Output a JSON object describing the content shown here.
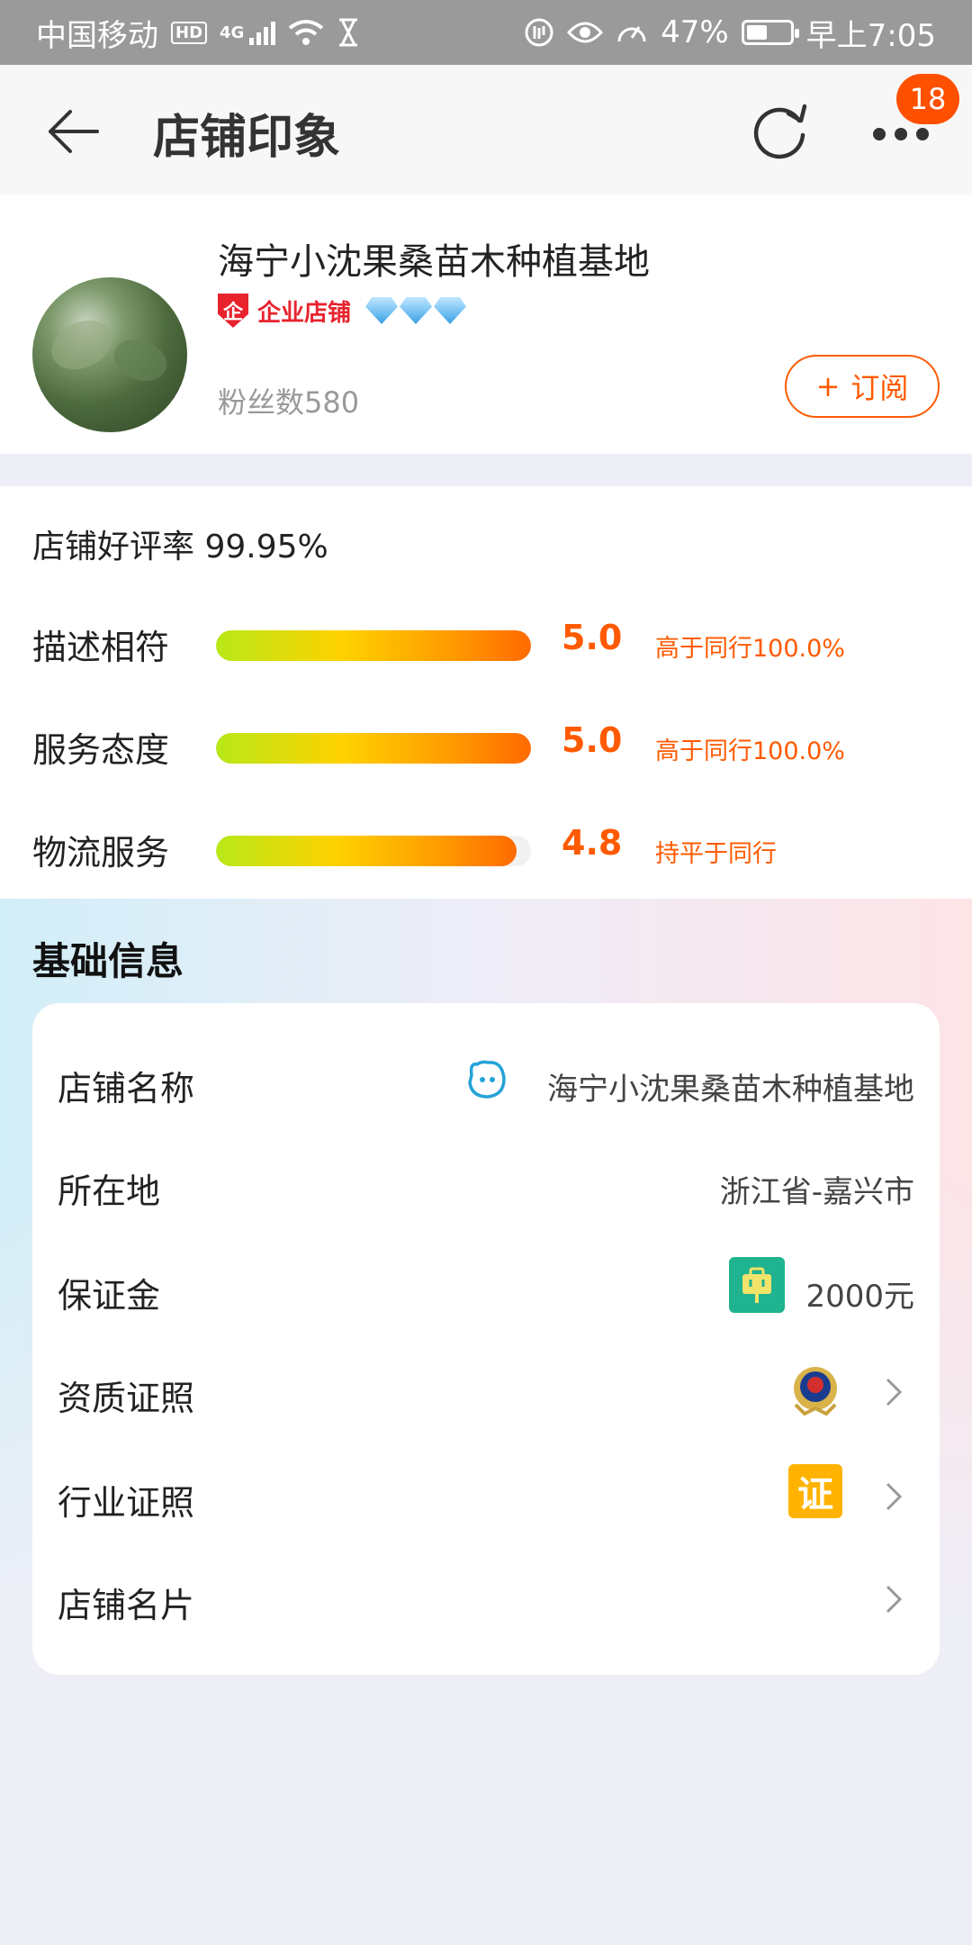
{
  "status_bar": {
    "carrier": "中国移动",
    "hd": "HD",
    "network": "4G",
    "battery": "47%",
    "time": "早上7:05"
  },
  "header": {
    "title": "店铺印象",
    "message_count": "18"
  },
  "shop": {
    "name": "海宁小沈果桑苗木种植基地",
    "enterprise_mark": "企",
    "enterprise_label": "企业店铺",
    "diamond_count": 3,
    "fans": "粉丝数580",
    "subscribe_label": "订阅",
    "subscribe_plus": "+"
  },
  "ratings": {
    "good_rate": "店铺好评率 99.95%",
    "items": [
      {
        "label": "描述相符",
        "score": "5.0",
        "bar_fraction": 1.0,
        "compare": "高于同行100.0%"
      },
      {
        "label": "服务态度",
        "score": "5.0",
        "bar_fraction": 1.0,
        "compare": "高于同行100.0%"
      },
      {
        "label": "物流服务",
        "score": "4.8",
        "bar_fraction": 0.955,
        "compare": "持平于同行"
      }
    ]
  },
  "basic_info": {
    "title": "基础信息",
    "rows": [
      {
        "label": "店铺名称",
        "value": "海宁小沈果桑苗木种植基地",
        "icon": "wangwang-icon"
      },
      {
        "label": "所在地",
        "value": "浙江省-嘉兴市"
      },
      {
        "label": "保证金",
        "value": "2000元",
        "icon": "deposit-icon"
      },
      {
        "label": "资质证照",
        "icon": "national-emblem-icon"
      },
      {
        "label": "行业证照",
        "icon": "certificate-icon",
        "icon_text": "证"
      },
      {
        "label": "店铺名片"
      }
    ]
  },
  "colors": {
    "accent": "#ff5a00",
    "badge": "#ff5000",
    "enterprise": "#e8232e"
  }
}
